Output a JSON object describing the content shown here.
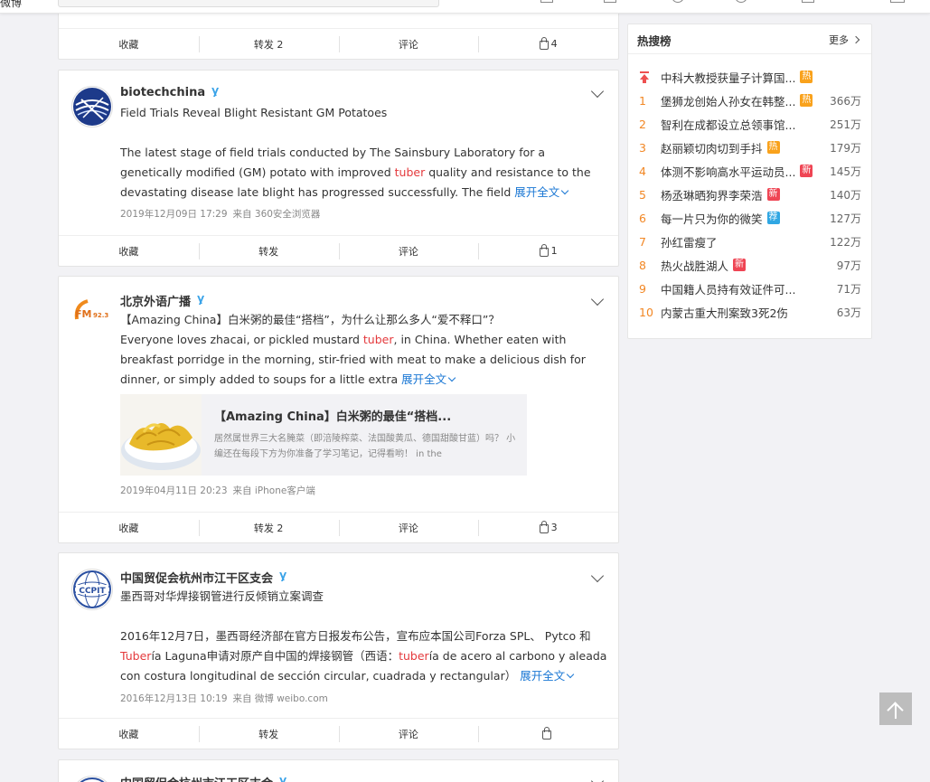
{
  "topbar": {
    "logo_fragment": "微博",
    "search_placeholder": ""
  },
  "colors": {
    "keyword_highlight": "#e4393c",
    "link_blue": "#1a77d4",
    "rank_orange": "#f28724",
    "tag_hot": "#f9a21c",
    "tag_new": "#ef4554",
    "tag_recommend": "#30a7e3"
  },
  "posts": [
    {
      "actions": {
        "fav": "收藏",
        "repost": "转发 2",
        "comment": "评论",
        "like": "4"
      }
    },
    {
      "author": "biotechchina",
      "verified": true,
      "lines": [
        "Field Trials Reveal Blight Resistant GM Potatoes"
      ],
      "body_pre": "The latest stage of field trials conducted by The Sainsbury Laboratory for a genetically modified (GM) potato with improved ",
      "body_kw": "tuber",
      "body_post": " quality and resistance to the devastating disease late blight has progressed successfully. The field ",
      "expand": "展开全文",
      "date": "2019年12月09日 17:29",
      "source": "来自 360安全浏览器",
      "actions": {
        "fav": "收藏",
        "repost": "转发",
        "comment": "评论",
        "like": "1"
      }
    },
    {
      "author": "北京外语广播",
      "verified": true,
      "headline": "【Amazing China】白米粥的最佳“搭档”，为什么让那么多人“爱不释口”？",
      "body_pre": "Everyone loves zhacai, or pickled mustard ",
      "body_kw": "tuber",
      "body_post": ", in China. Whether eaten with breakfast porridge in the morning, stir-fried with meat to make a delicious dish for dinner, or simply added to soups for a little extra ",
      "expand": "展开全文",
      "link_card": {
        "title": "【Amazing China】白米粥的最佳“搭档...",
        "desc": "居然属世界三大名腌菜（即涪陵榨菜、法国酸黄瓜、德国甜酸甘蓝）吗？ 小编还在每段下方为你准备了学习笔记，记得看哟！ in the"
      },
      "date": "2019年04月11日 20:23",
      "source": "来自 iPhone客户端",
      "actions": {
        "fav": "收藏",
        "repost": "转发 2",
        "comment": "评论",
        "like": "3"
      }
    },
    {
      "author": "中国贸促会杭州市江干区支会",
      "verified": true,
      "headline": "墨西哥对华焊接钢管进行反倾销立案调查",
      "body_a": "2016年12月7日，墨西哥经济部在官方日报发布公告，宣布应本国公司Forza SPL、 Pytco 和 ",
      "body_kw1": "Tuber",
      "body_b": "ía Laguna申请对原产自中国的焊接钢管（西语：",
      "body_kw2": "tuber",
      "body_c": "ía de acero al carbono y aleada con costura longitudinal de sección circular, cuadrada y rectangular） ",
      "expand": "展开全文",
      "date": "2016年12月13日 10:19",
      "source": "来自 微博 weibo.com",
      "actions": {
        "fav": "收藏",
        "repost": "转发",
        "comment": "评论",
        "like": ""
      }
    },
    {
      "author": "中国贸促会杭州市江干区支会"
    }
  ],
  "hot_search": {
    "title": "热搜榜",
    "more": "更多",
    "pinned": {
      "text": "中科大教授获量子计算国...",
      "tag": "热",
      "tag_type": "hot"
    },
    "items": [
      {
        "rank": "1",
        "text": "堡狮龙创始人孙女在韩整...",
        "tag": "热",
        "tag_type": "hot",
        "count": "366万"
      },
      {
        "rank": "2",
        "text": "智利在成都设立总领事馆...",
        "tag": "",
        "tag_type": "",
        "count": "251万"
      },
      {
        "rank": "3",
        "text": "赵丽颖切肉切到手抖",
        "tag": "热",
        "tag_type": "hot",
        "count": "179万"
      },
      {
        "rank": "4",
        "text": "体测不影响高水平运动员...",
        "tag": "新",
        "tag_type": "new",
        "count": "145万"
      },
      {
        "rank": "5",
        "text": "杨丞琳晒狗界李荣浩",
        "tag": "新",
        "tag_type": "new",
        "count": "140万"
      },
      {
        "rank": "6",
        "text": "每一片只为你的微笑",
        "tag": "荐",
        "tag_type": "rec",
        "count": "127万"
      },
      {
        "rank": "7",
        "text": "孙红雷瘦了",
        "tag": "",
        "tag_type": "",
        "count": "122万"
      },
      {
        "rank": "8",
        "text": "热火战胜湖人",
        "tag": "新",
        "tag_type": "new",
        "count": "97万"
      },
      {
        "rank": "9",
        "text": "中国籍人员持有效证件可...",
        "tag": "",
        "tag_type": "",
        "count": "71万"
      },
      {
        "rank": "10",
        "text": "内蒙古重大刑案致3死2伤",
        "tag": "",
        "tag_type": "",
        "count": "63万"
      }
    ]
  }
}
